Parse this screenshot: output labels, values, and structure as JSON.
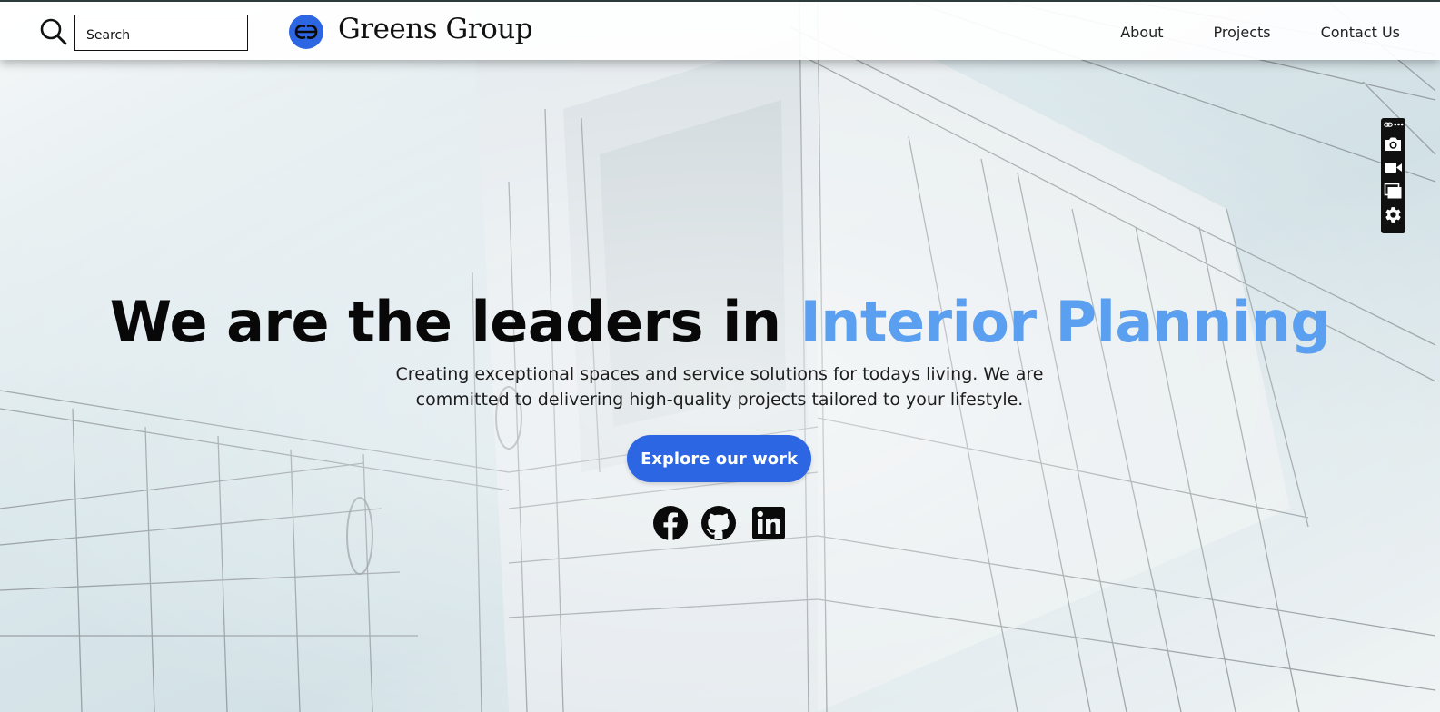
{
  "header": {
    "search": {
      "placeholder": "Search",
      "value": ""
    },
    "brand": "Greens Group",
    "nav": [
      {
        "label": "About"
      },
      {
        "label": "Projects"
      },
      {
        "label": "Contact Us"
      }
    ]
  },
  "hero": {
    "headline_main": "We are the leaders in ",
    "headline_accent": "Interior Planning",
    "subtitle": "Creating exceptional spaces and service solutions for todays living. We are committed to delivering high-quality projects tailored to your lifestyle.",
    "cta_label": "Explore our work",
    "social": [
      "facebook-icon",
      "github-icon",
      "linkedin-icon"
    ]
  },
  "toolbar": {
    "icons": [
      "link-icon",
      "more-icon",
      "camera-icon",
      "video-icon",
      "window-icon",
      "settings-icon"
    ]
  },
  "colors": {
    "accent": "#5b9ff0",
    "button": "#2d66e3",
    "header_border": "#2c3b3b",
    "text": "#080808"
  }
}
